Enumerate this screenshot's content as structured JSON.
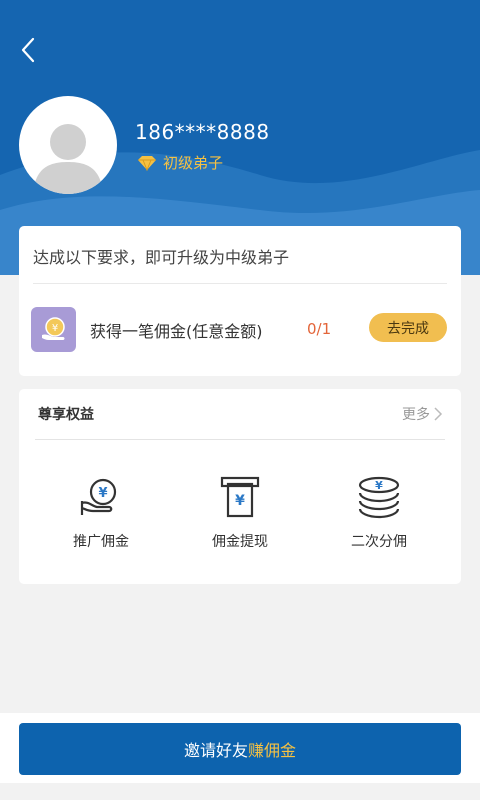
{
  "profile": {
    "phone": "186****8888",
    "level": "初级弟子"
  },
  "requirement": {
    "text": "达成以下要求，即可升级为中级弟子",
    "task_label": "获得一笔佣金(任意金额)",
    "progress": "0/1",
    "action_label": "去完成"
  },
  "benefits": {
    "title": "尊享权益",
    "more_label": "更多",
    "items": [
      {
        "label": "推广佣金",
        "icon": "hand-coin-icon"
      },
      {
        "label": "佣金提现",
        "icon": "withdraw-icon"
      },
      {
        "label": "二次分佣",
        "icon": "coin-stack-icon"
      }
    ]
  },
  "invite": {
    "prefix": "邀请好友",
    "highlight": "赚佣金"
  },
  "colors": {
    "header_blue": "#1565b0",
    "gold": "#f5c143",
    "progress_red": "#e3653a",
    "button_blue": "#0d63ae"
  }
}
